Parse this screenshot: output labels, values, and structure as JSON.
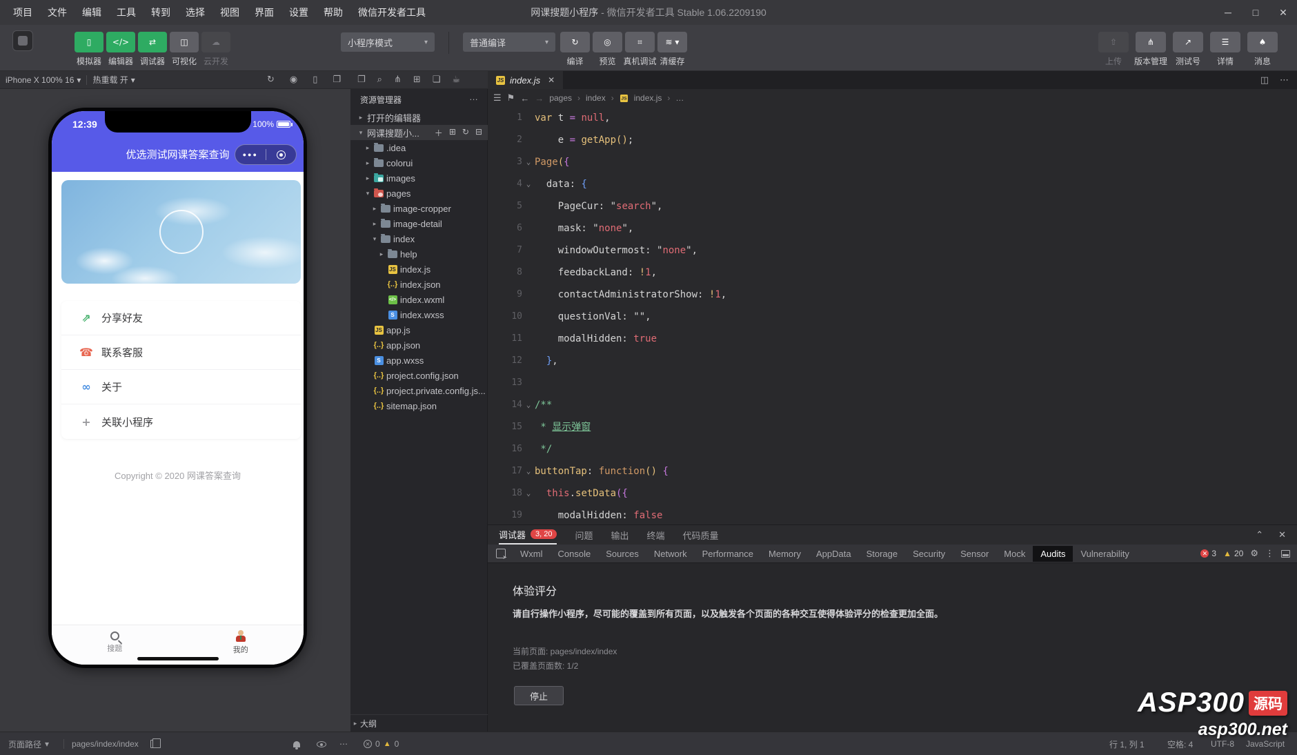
{
  "window": {
    "menus": [
      "项目",
      "文件",
      "编辑",
      "工具",
      "转到",
      "选择",
      "视图",
      "界面",
      "设置",
      "帮助",
      "微信开发者工具"
    ],
    "title_project": "网课搜题小程序",
    "title_rest": " - 微信开发者工具 Stable 1.06.2209190",
    "controls": {
      "minimize": "─",
      "maximize": "□",
      "close": "✕"
    }
  },
  "toolbar": {
    "left_buttons": [
      {
        "label": "模拟器",
        "icon": "simulator-icon",
        "glyph": "▯",
        "style": "green"
      },
      {
        "label": "编辑器",
        "icon": "editor-icon",
        "glyph": "</>",
        "style": "green"
      },
      {
        "label": "调试器",
        "icon": "debugger-icon",
        "glyph": "⇄",
        "style": "green"
      },
      {
        "label": "可视化",
        "icon": "visual-icon",
        "glyph": "◫",
        "style": "gray"
      },
      {
        "label": "云开发",
        "icon": "cloud-icon",
        "glyph": "☁",
        "style": "disabled"
      }
    ],
    "mode_select": "小程序模式",
    "compile_select": "普通编译",
    "compile_buttons": [
      {
        "label": "编译",
        "icon": "compile-icon",
        "glyph": "↻",
        "style": "gray"
      },
      {
        "label": "预览",
        "icon": "preview-icon",
        "glyph": "◎",
        "style": "dim"
      },
      {
        "label": "真机调试",
        "icon": "remote-debug-icon",
        "glyph": "⌗",
        "style": "dim"
      },
      {
        "label": "清缓存",
        "icon": "clear-cache-icon",
        "glyph": "≋ ▾",
        "style": "gray"
      }
    ],
    "right_buttons": [
      {
        "label": "上传",
        "icon": "upload-icon",
        "glyph": "⇧",
        "style": "disabled"
      },
      {
        "label": "版本管理",
        "icon": "version-icon",
        "glyph": "⋔",
        "style": "gray"
      },
      {
        "label": "测试号",
        "icon": "testid-icon",
        "glyph": "↗",
        "style": "gray"
      },
      {
        "label": "详情",
        "icon": "details-icon",
        "glyph": "☰",
        "style": "gray"
      },
      {
        "label": "消息",
        "icon": "message-icon",
        "glyph": "♠",
        "style": "gray"
      }
    ]
  },
  "simulator": {
    "device_label": "iPhone X 100% 16",
    "hot_reload_label": "热重载 开",
    "caret": "▾"
  },
  "phone": {
    "time": "12:39",
    "battery": "100%",
    "nav_title": "优选测试网课答案查询",
    "capsule_dots": "●●●",
    "menu": [
      {
        "label": "分享好友",
        "icon": "share-icon",
        "glyph": "⇗",
        "color": "#3fae67"
      },
      {
        "label": "联系客服",
        "icon": "support-icon",
        "glyph": "☎",
        "color": "#e8654f"
      },
      {
        "label": "关于",
        "icon": "about-icon",
        "glyph": "∞",
        "color": "#4a90e2"
      },
      {
        "label": "关联小程序",
        "icon": "link-miniprogram-icon",
        "glyph": "+",
        "color": "#9a9a9e"
      }
    ],
    "copyright": "Copyright © 2020 网课答案查询",
    "tabs": [
      {
        "label": "搜题"
      },
      {
        "label": "我的"
      }
    ]
  },
  "explorer": {
    "title": "资源管理器",
    "more": "…",
    "outline": "大纲",
    "tree": [
      {
        "depth": 0,
        "arrow": "▸",
        "icon": "none",
        "label": "打开的编辑器"
      },
      {
        "depth": 0,
        "arrow": "▾",
        "icon": "none",
        "label": "网课搜题小...",
        "selected": true,
        "actions": [
          "＋",
          "⊞",
          "↻",
          "⊟"
        ]
      },
      {
        "depth": 1,
        "arrow": "▸",
        "icon": "folder",
        "label": ".idea"
      },
      {
        "depth": 1,
        "arrow": "▸",
        "icon": "folder",
        "label": "colorui"
      },
      {
        "depth": 1,
        "arrow": "▸",
        "icon": "folder-teal",
        "label": "images"
      },
      {
        "depth": 1,
        "arrow": "▾",
        "icon": "folder-red",
        "label": "pages"
      },
      {
        "depth": 2,
        "arrow": "▸",
        "icon": "folder",
        "label": "image-cropper"
      },
      {
        "depth": 2,
        "arrow": "▸",
        "icon": "folder",
        "label": "image-detail"
      },
      {
        "depth": 2,
        "arrow": "▾",
        "icon": "folder",
        "label": "index"
      },
      {
        "depth": 3,
        "arrow": "▸",
        "icon": "folder",
        "label": "help"
      },
      {
        "depth": 3,
        "arrow": "",
        "icon": "js",
        "label": "index.js"
      },
      {
        "depth": 3,
        "arrow": "",
        "icon": "json",
        "label": "index.json"
      },
      {
        "depth": 3,
        "arrow": "",
        "icon": "wxml",
        "label": "index.wxml"
      },
      {
        "depth": 3,
        "arrow": "",
        "icon": "wxss",
        "label": "index.wxss"
      },
      {
        "depth": 1,
        "arrow": "",
        "icon": "js",
        "label": "app.js"
      },
      {
        "depth": 1,
        "arrow": "",
        "icon": "json",
        "label": "app.json"
      },
      {
        "depth": 1,
        "arrow": "",
        "icon": "wxss",
        "label": "app.wxss"
      },
      {
        "depth": 1,
        "arrow": "",
        "icon": "json",
        "label": "project.config.json"
      },
      {
        "depth": 1,
        "arrow": "",
        "icon": "json",
        "label": "project.private.config.js..."
      },
      {
        "depth": 1,
        "arrow": "",
        "icon": "json",
        "label": "sitemap.json"
      }
    ]
  },
  "editor": {
    "tab": {
      "label": "index.js",
      "close": "✕"
    },
    "breadcrumb": [
      "pages",
      "index",
      "index.js",
      "…"
    ],
    "code": [
      {
        "n": 1,
        "fold": false,
        "segs": [
          [
            "c-y",
            "var "
          ],
          [
            "c-w",
            "t "
          ],
          [
            "c-p",
            "= "
          ],
          [
            "c-r",
            "null"
          ],
          [
            "c-w",
            ","
          ]
        ]
      },
      {
        "n": 2,
        "fold": false,
        "segs": [
          [
            "c-w",
            "    e "
          ],
          [
            "c-p",
            "= "
          ],
          [
            "c-y",
            "getApp"
          ],
          [
            "c-y",
            "()"
          ],
          [
            "c-w",
            ";"
          ]
        ]
      },
      {
        "n": 3,
        "fold": true,
        "segs": [
          [
            "c-o",
            "Page"
          ],
          [
            "c-y",
            "("
          ],
          [
            "c-p",
            "{"
          ]
        ]
      },
      {
        "n": 4,
        "fold": true,
        "segs": [
          [
            "c-w",
            "  data: "
          ],
          [
            "c-bl",
            "{"
          ]
        ]
      },
      {
        "n": 5,
        "fold": false,
        "segs": [
          [
            "c-w",
            "    PageCur: \""
          ],
          [
            "c-r",
            "search"
          ],
          [
            "c-w",
            "\","
          ]
        ]
      },
      {
        "n": 6,
        "fold": false,
        "segs": [
          [
            "c-w",
            "    mask: \""
          ],
          [
            "c-r",
            "none"
          ],
          [
            "c-w",
            "\","
          ]
        ]
      },
      {
        "n": 7,
        "fold": false,
        "segs": [
          [
            "c-w",
            "    windowOutermost: \""
          ],
          [
            "c-r",
            "none"
          ],
          [
            "c-w",
            "\","
          ]
        ]
      },
      {
        "n": 8,
        "fold": false,
        "segs": [
          [
            "c-w",
            "    feedbackLand: "
          ],
          [
            "c-y",
            "!"
          ],
          [
            "c-r",
            "1"
          ],
          [
            "c-w",
            ","
          ]
        ]
      },
      {
        "n": 9,
        "fold": false,
        "segs": [
          [
            "c-w",
            "    contactAdministratorShow: "
          ],
          [
            "c-y",
            "!"
          ],
          [
            "c-r",
            "1"
          ],
          [
            "c-w",
            ","
          ]
        ]
      },
      {
        "n": 10,
        "fold": false,
        "segs": [
          [
            "c-w",
            "    questionVal: \"\","
          ]
        ]
      },
      {
        "n": 11,
        "fold": false,
        "segs": [
          [
            "c-w",
            "    modalHidden: "
          ],
          [
            "c-r",
            "true"
          ]
        ]
      },
      {
        "n": 12,
        "fold": false,
        "segs": [
          [
            "c-w",
            "  "
          ],
          [
            "c-bl",
            "}"
          ],
          [
            "c-w",
            ","
          ]
        ]
      },
      {
        "n": 13,
        "fold": false,
        "segs": []
      },
      {
        "n": 14,
        "fold": true,
        "segs": [
          [
            "c-g",
            "/**"
          ]
        ]
      },
      {
        "n": 15,
        "fold": false,
        "segs": [
          [
            "c-g",
            " * "
          ],
          [
            "c-gu",
            "显示弹窗"
          ]
        ]
      },
      {
        "n": 16,
        "fold": false,
        "segs": [
          [
            "c-g",
            " */"
          ]
        ]
      },
      {
        "n": 17,
        "fold": true,
        "segs": [
          [
            "c-y",
            "buttonTap"
          ],
          [
            "c-w",
            ": "
          ],
          [
            "c-o",
            "function"
          ],
          [
            "c-y",
            "()"
          ],
          [
            "c-w",
            " "
          ],
          [
            "c-p",
            "{"
          ]
        ]
      },
      {
        "n": 18,
        "fold": true,
        "segs": [
          [
            "c-w",
            "  "
          ],
          [
            "c-r",
            "this"
          ],
          [
            "c-w",
            "."
          ],
          [
            "c-y",
            "setData"
          ],
          [
            "c-p",
            "({"
          ]
        ]
      },
      {
        "n": 19,
        "fold": false,
        "segs": [
          [
            "c-w",
            "    modalHidden: "
          ],
          [
            "c-r",
            "false"
          ]
        ]
      }
    ]
  },
  "debugger": {
    "row1_tabs": [
      {
        "label": "调试器",
        "active": true,
        "badge": "3, 20"
      },
      {
        "label": "问题"
      },
      {
        "label": "输出"
      },
      {
        "label": "终端"
      },
      {
        "label": "代码质量"
      }
    ],
    "row1_icons": {
      "collapse": "⌃",
      "close": "✕"
    },
    "row2_tabs": [
      "Wxml",
      "Console",
      "Sources",
      "Network",
      "Performance",
      "Memory",
      "AppData",
      "Storage",
      "Security",
      "Sensor",
      "Mock",
      "Audits",
      "Vulnerability"
    ],
    "row2_active": "Audits",
    "error_count": "3",
    "warning_count": "20",
    "audit": {
      "title": "体验评分",
      "desc": "请自行操作小程序，尽可能的覆盖到所有页面，以及触发各个页面的各种交互使得体验评分的检查更加全面。",
      "current_page": "当前页面: pages/index/index",
      "coverage": "已覆盖页面数: 1/2",
      "stop_label": "停止"
    }
  },
  "statusbar": {
    "page_path_label": "页面路径",
    "caret": "▾",
    "page_path": "pages/index/index",
    "error_count": "0",
    "warning_count": "0",
    "right_items": [
      "行 1, 列 1",
      "空格: 4",
      "UTF-8",
      "JavaScript"
    ]
  },
  "watermark": {
    "brand": "ASP300",
    "tag": "源码",
    "site": "asp300.net"
  },
  "colors": {
    "accent_green": "#2eab62",
    "phone_purple": "#575ae8",
    "badge_red": "#e04545",
    "warn_yellow": "#e2b93d"
  }
}
